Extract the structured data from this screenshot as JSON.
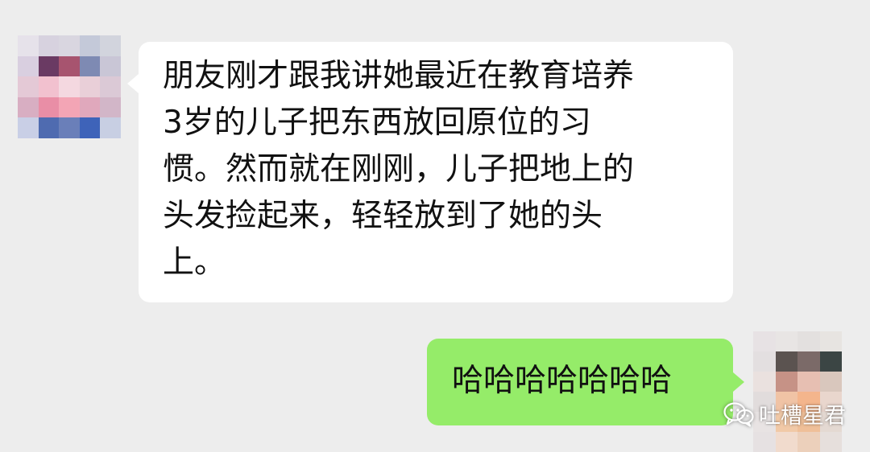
{
  "chat": {
    "incoming": {
      "lines": [
        "朋友刚才跟我讲她最近在教育培养",
        "3岁的儿子把东西放回原位的习",
        "惯。然而就在刚刚，儿子把地上的",
        "头发捡起来，轻轻放到了她的头",
        "上。"
      ]
    },
    "outgoing": {
      "text": "哈哈哈哈哈哈哈"
    }
  },
  "watermark": {
    "icon": "wechat-icon",
    "text": "吐槽星君"
  },
  "colors": {
    "background": "#ededed",
    "incoming_bubble": "#ffffff",
    "outgoing_bubble": "#95ec69",
    "text": "#111111",
    "left_avatar_pixels": [
      "#e6e2ea",
      "#d7d2df",
      "#d9d6e0",
      "#c4c9d9",
      "#d2d4dd",
      "#d9cfe0",
      "#6a3a63",
      "#a7546f",
      "#7e8ab3",
      "#c9c6d6",
      "#e4c9d6",
      "#f2c1cf",
      "#f4d8e0",
      "#e9cfd8",
      "#dbc9d6",
      "#d8aec2",
      "#e98ea6",
      "#f3a5b5",
      "#e0a8bc",
      "#d2b6c8",
      "#c9cfe6",
      "#4f6bb0",
      "#6a7fb9",
      "#3e63b9",
      "#c8cfe3"
    ],
    "right_avatar_pixels": [
      "#e7e2e4",
      "#e8e5e4",
      "#e3e0df",
      "#e7e4e1",
      "#e3dfe0",
      "#5b5350",
      "#7b6a68",
      "#3b4544",
      "#eae1df",
      "#c69286",
      "#e7bfb2",
      "#d9c7bd",
      "#e1dcdc",
      "#f0c3a5",
      "#f4b58c",
      "#e9d6cd",
      "#e8e3e3",
      "#f1c9a7",
      "#efbf98",
      "#e4d9d2",
      "#e6e1e2",
      "#f1dbcd",
      "#ecd0bb",
      "#e6dfdc"
    ]
  }
}
